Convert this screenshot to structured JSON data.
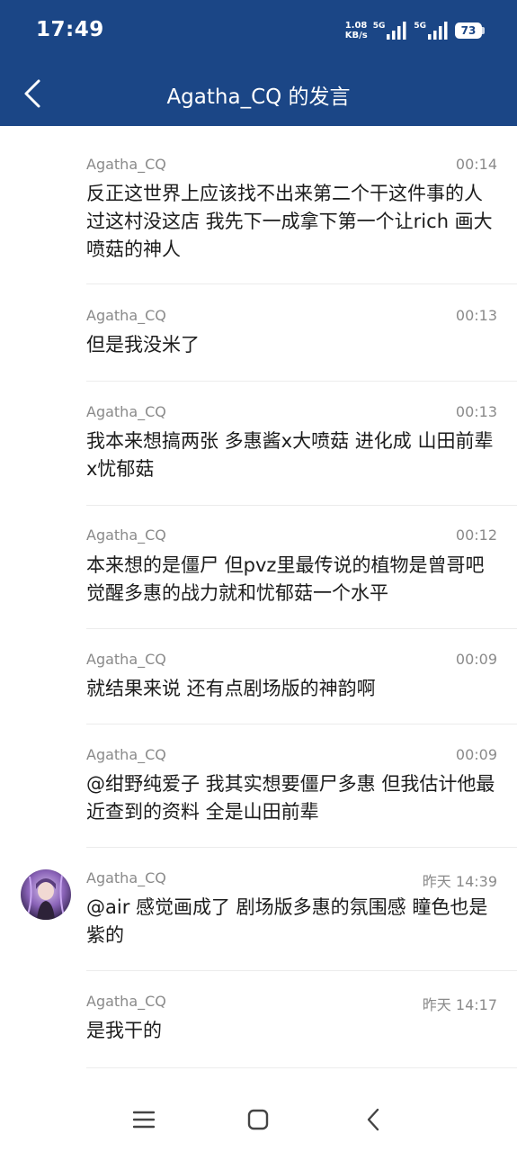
{
  "status_bar": {
    "time": "17:49",
    "net_speed_value": "1.08",
    "net_speed_unit": "KB/s",
    "signal1_label": "5G",
    "signal2_label": "5G",
    "battery_level": "73"
  },
  "header": {
    "title": "Agatha_CQ 的发言",
    "back_icon": "chevron-left-icon"
  },
  "posts": [
    {
      "author": "Agatha_CQ",
      "time": "00:14",
      "text": "反正这世界上应该找不出来第二个干这件事的人 过这村没这店 我先下一成拿下第一个让rich 画大喷菇的神人",
      "has_avatar": false
    },
    {
      "author": "Agatha_CQ",
      "time": "00:13",
      "text": "但是我没米了",
      "has_avatar": false
    },
    {
      "author": "Agatha_CQ",
      "time": "00:13",
      "text": "我本来想搞两张 多惠酱x大喷菇 进化成 山田前辈x忧郁菇",
      "has_avatar": false
    },
    {
      "author": "Agatha_CQ",
      "time": "00:12",
      "text": "本来想的是僵尸 但pvz里最传说的植物是曾哥吧 觉醒多惠的战力就和忧郁菇一个水平",
      "has_avatar": false
    },
    {
      "author": "Agatha_CQ",
      "time": "00:09",
      "text": "就结果来说 还有点剧场版的神韵啊",
      "has_avatar": false
    },
    {
      "author": "Agatha_CQ",
      "time": "00:09",
      "text": "@绀野纯爱子 我其实想要僵尸多惠 但我估计他最近查到的资料 全是山田前辈",
      "has_avatar": false
    },
    {
      "author": "Agatha_CQ",
      "time": "昨天 14:39",
      "text": "@air 感觉画成了 剧场版多惠的氛围感 瞳色也是紫的",
      "has_avatar": true
    },
    {
      "author": "Agatha_CQ",
      "time": "昨天 14:17",
      "text": "是我干的",
      "has_avatar": false
    }
  ],
  "nav_bar": {
    "menu_icon": "menu-icon",
    "home_icon": "home-icon",
    "back_icon": "back-icon"
  },
  "colors": {
    "header_bg": "#1b4686",
    "meta_text": "#8a8a8a",
    "body_text": "#1c1c1c"
  }
}
